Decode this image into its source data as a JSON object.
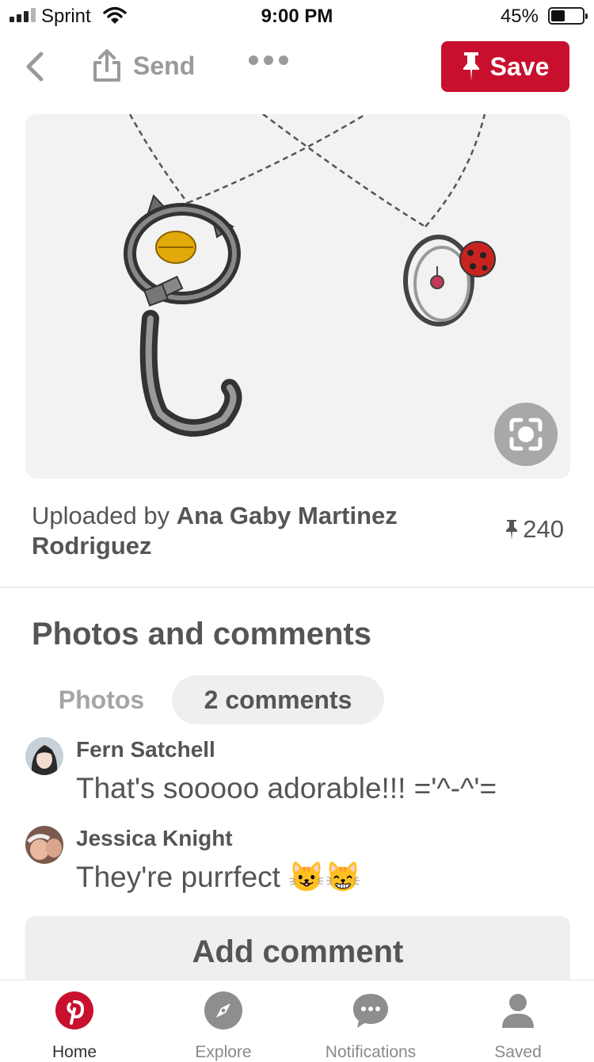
{
  "status_bar": {
    "carrier": "Sprint",
    "time": "9:00 PM",
    "battery_percent": "45%",
    "battery_level": 0.45
  },
  "top_nav": {
    "send_label": "Send",
    "save_label": "Save"
  },
  "pin": {
    "uploaded_prefix": "Uploaded by ",
    "uploader_name": "Ana Gaby Martinez Rodriguez",
    "save_count": "240"
  },
  "comments_section": {
    "title": "Photos and comments",
    "tab_photos": "Photos",
    "tab_comments": "2 comments",
    "comments": [
      {
        "author": "Fern Satchell",
        "text": "That's sooooo adorable!!! ='^-^'="
      },
      {
        "author": "Jessica Knight",
        "text": "They're purrfect 😺😸"
      }
    ],
    "add_comment_label": "Add comment"
  },
  "tab_bar": {
    "items": [
      {
        "label": "Home",
        "icon": "pinterest-logo-icon"
      },
      {
        "label": "Explore",
        "icon": "compass-icon"
      },
      {
        "label": "Notifications",
        "icon": "speech-bubble-icon"
      },
      {
        "label": "Saved",
        "icon": "profile-icon"
      }
    ]
  },
  "colors": {
    "brand_red": "#c8102e",
    "muted_text": "#555555",
    "inactive_gray": "#9a9a9a"
  }
}
